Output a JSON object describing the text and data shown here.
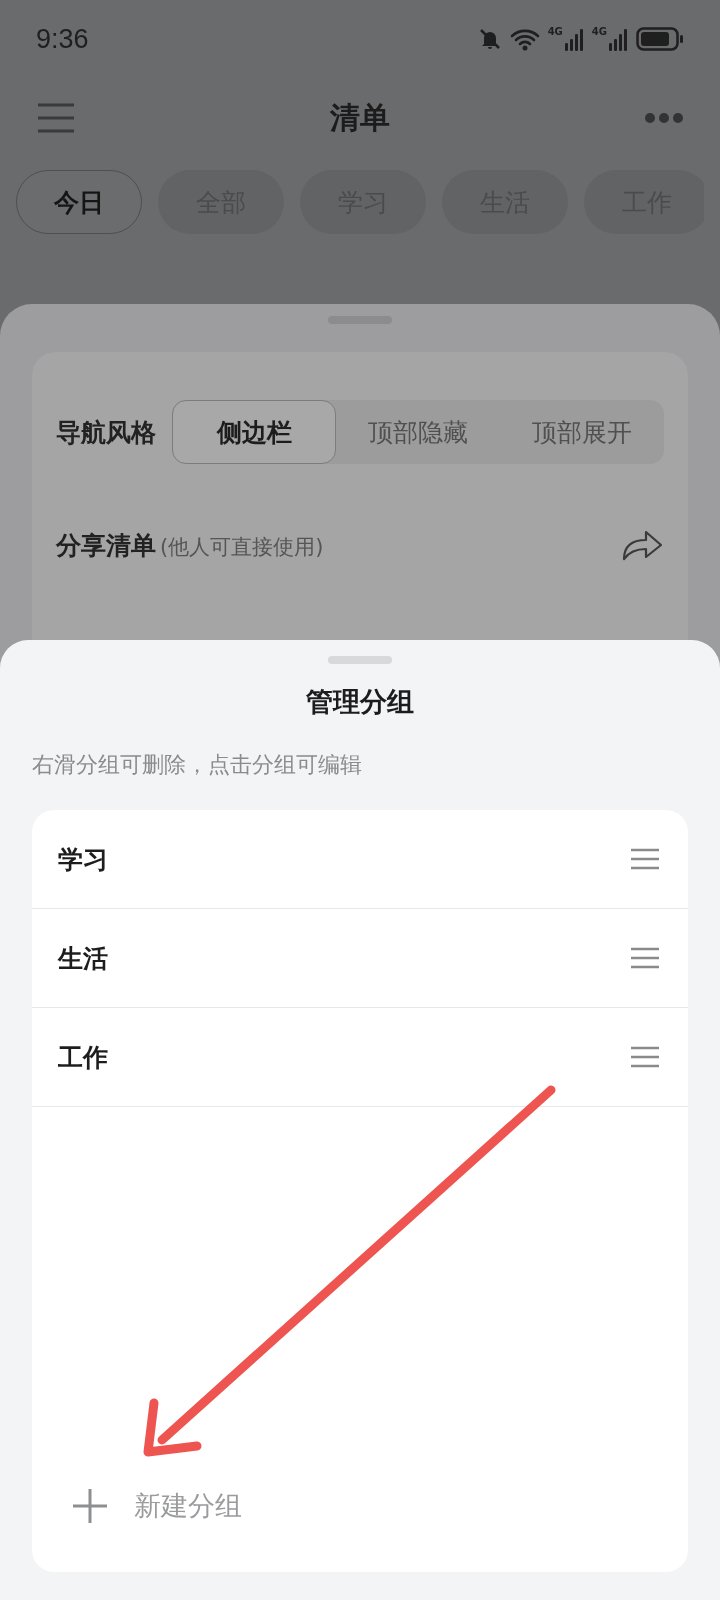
{
  "status_bar": {
    "time": "9:36",
    "networks": [
      "4G",
      "4G"
    ]
  },
  "header": {
    "title": "清单"
  },
  "tabs": [
    {
      "label": "今日",
      "selected": true
    },
    {
      "label": "全部",
      "selected": false
    },
    {
      "label": "学习",
      "selected": false
    },
    {
      "label": "生活",
      "selected": false
    },
    {
      "label": "工作",
      "selected": false
    }
  ],
  "settings": {
    "nav_style": {
      "label": "导航风格",
      "options": [
        {
          "label": "侧边栏",
          "selected": true
        },
        {
          "label": "顶部隐藏",
          "selected": false
        },
        {
          "label": "顶部展开",
          "selected": false
        }
      ]
    },
    "share": {
      "label": "分享清单",
      "hint": "(他人可直接使用)"
    }
  },
  "manage_sheet": {
    "title": "管理分组",
    "hint": "右滑分组可删除，点击分组可编辑",
    "groups": [
      {
        "name": "学习"
      },
      {
        "name": "生活"
      },
      {
        "name": "工作"
      }
    ],
    "new_group": "新建分组"
  }
}
